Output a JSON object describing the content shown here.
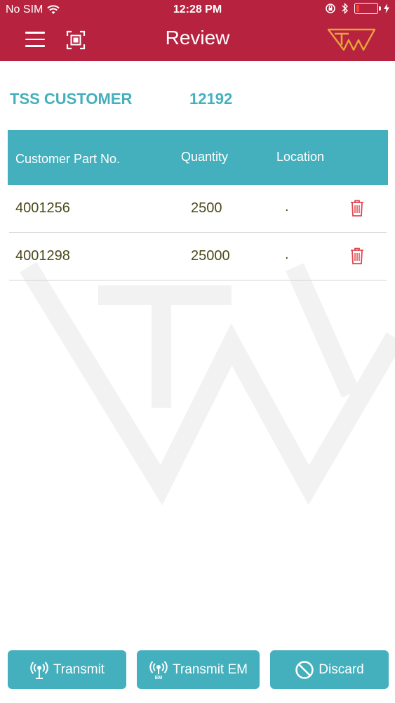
{
  "status_bar": {
    "carrier": "No SIM",
    "time": "12:28 PM"
  },
  "nav": {
    "title": "Review"
  },
  "customer": {
    "name": "TSS CUSTOMER",
    "number": "12192"
  },
  "table": {
    "headers": {
      "part": "Customer Part No.",
      "quantity": "Quantity",
      "location": "Location"
    },
    "rows": [
      {
        "part": "4001256",
        "quantity": "2500",
        "location": "."
      },
      {
        "part": "4001298",
        "quantity": "25000",
        "location": "."
      }
    ]
  },
  "actions": {
    "transmit": "Transmit",
    "transmit_em": "Transmit EM",
    "discard": "Discard"
  },
  "colors": {
    "brand_red": "#b7223f",
    "accent_teal": "#45b0bd",
    "logo_gold": "#e8a43a",
    "trash_red": "#e0454f"
  },
  "icons": {
    "menu": "hamburger-menu-icon",
    "scan": "scan-frame-icon",
    "trash": "trash-icon",
    "transmit": "broadcast-icon",
    "discard": "prohibited-icon"
  }
}
